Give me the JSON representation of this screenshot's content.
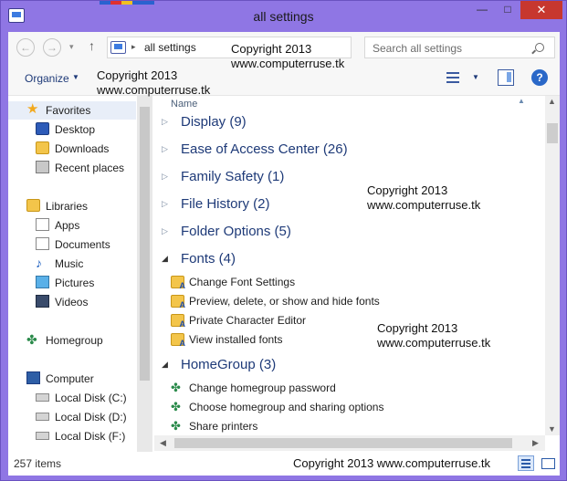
{
  "window": {
    "title": "all settings",
    "close_glyph": "✕",
    "minimize_glyph": "—",
    "maximize_glyph": "□"
  },
  "navbar": {
    "back_glyph": "←",
    "forward_glyph": "→",
    "up_glyph": "↑",
    "address_text": "all settings",
    "refresh_glyph": "↻",
    "search_placeholder": "Search all settings"
  },
  "commandbar": {
    "organize_label": "Organize",
    "help_glyph": "?"
  },
  "nav_pane": {
    "favorites": {
      "label": "Favorites",
      "items": [
        "Desktop",
        "Downloads",
        "Recent places"
      ]
    },
    "libraries": {
      "label": "Libraries",
      "items": [
        "Apps",
        "Documents",
        "Music",
        "Pictures",
        "Videos"
      ]
    },
    "homegroup": {
      "label": "Homegroup"
    },
    "computer": {
      "label": "Computer",
      "items": [
        "Local Disk  (C:)",
        "Local Disk (D:)",
        "Local Disk (F:)"
      ]
    }
  },
  "content": {
    "column_name": "Name",
    "groups": [
      {
        "label": "Display (9)",
        "expanded": false
      },
      {
        "label": "Ease of Access Center (26)",
        "expanded": false
      },
      {
        "label": "Family Safety (1)",
        "expanded": false
      },
      {
        "label": "File History (2)",
        "expanded": false
      },
      {
        "label": "Folder Options (5)",
        "expanded": false
      },
      {
        "label": "Fonts (4)",
        "expanded": true,
        "items": [
          "Change Font Settings",
          "Preview, delete, or show and hide fonts",
          "Private Character Editor",
          "View installed fonts"
        ]
      },
      {
        "label": "HomeGroup (3)",
        "expanded": true,
        "items": [
          "Change homegroup password",
          "Choose homegroup and sharing options",
          "Share printers"
        ]
      }
    ]
  },
  "status": {
    "item_count": "257 items"
  },
  "watermarks": {
    "line1": "Copyright 2013",
    "line2": "www.computerruse.tk",
    "single": "Copyright 2013 www.computerruse.tk"
  }
}
